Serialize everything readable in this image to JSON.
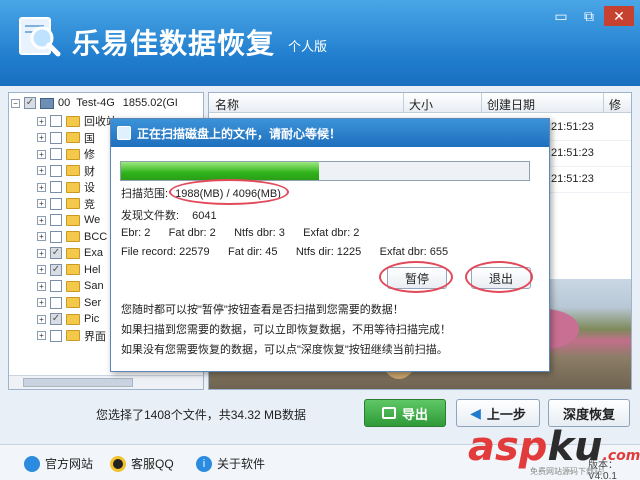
{
  "app": {
    "title": "乐易佳数据恢复",
    "edition": "个人版",
    "window_buttons": [
      "▭",
      "⧉",
      "✕"
    ]
  },
  "tree": {
    "root": {
      "index": "00",
      "label": "Test-4G",
      "size": "1855.02(GI"
    },
    "items": [
      {
        "label": "回收站",
        "checked": false
      },
      {
        "label": "国",
        "checked": false
      },
      {
        "label": "修",
        "checked": false
      },
      {
        "label": "财",
        "checked": false
      },
      {
        "label": "设",
        "checked": false
      },
      {
        "label": "竞",
        "checked": false
      },
      {
        "label": "We",
        "checked": false
      },
      {
        "label": "BCC",
        "checked": false
      },
      {
        "label": "Exa",
        "checked": true
      },
      {
        "label": "Hel",
        "checked": true
      },
      {
        "label": "San",
        "checked": false
      },
      {
        "label": "Ser",
        "checked": false
      },
      {
        "label": "Pic",
        "checked": true
      },
      {
        "label": "界面",
        "checked": false
      }
    ]
  },
  "list": {
    "columns": [
      "名称",
      "大小",
      "创建日期",
      "修"
    ],
    "rows": [
      {
        "time": "21:51:23"
      },
      {
        "time": "21:51:23"
      },
      {
        "time": "21:51:23"
      }
    ]
  },
  "status": {
    "selection_text": "您选择了1408个文件，共34.32 MB数据"
  },
  "buttons": {
    "export": "导出",
    "prev": "上一步",
    "deep": "深度恢复"
  },
  "footer": {
    "official_site": "官方网站",
    "support_qq": "客服QQ",
    "about": "关于软件",
    "version": "版本：V4.0.1"
  },
  "watermark": {
    "main_red": "asp",
    "main_dark": "ku",
    "suffix": ".com",
    "sub": "免费网站源码下载站!"
  },
  "dialog": {
    "title": "正在扫描磁盘上的文件，请耐心等候！",
    "progress_fraction": 0.4854,
    "scan_range_label": "扫描范围:",
    "scan_range_value": "1988(MB) / 4096(MB)",
    "found_label": "发现文件数:",
    "found_value": "6041",
    "ebr_line": "Ebr: 2      Fat dbr: 2      Ntfs dbr: 3      Exfat dbr: 2",
    "record_line": "File record: 22579      Fat dir: 45      Ntfs dir: 1225      Exfat dbr: 655",
    "pause": "暂停",
    "exit": "退出",
    "tips": [
      "您随时都可以按\"暂停\"按钮查看是否扫描到您需要的数据！",
      "如果扫描到您需要的数据，可以立即恢复数据，不用等待扫描完成！",
      "如果没有您需要恢复的数据，可以点\"深度恢复\"按钮继续当前扫描。"
    ]
  },
  "colors": {
    "titlebar": "#1f7ccd",
    "progress": "#2fb31a",
    "highlight_ring": "#e24a5a",
    "export_button": "#2f9a38"
  }
}
